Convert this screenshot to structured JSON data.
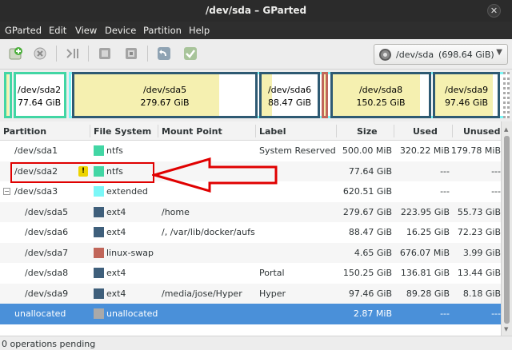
{
  "window": {
    "title": "/dev/sda – GParted",
    "close_glyph": "✕"
  },
  "menu": [
    "GParted",
    "Edit",
    "View",
    "Device",
    "Partition",
    "Help"
  ],
  "toolbar": {
    "buttons": [
      "new-partition",
      "delete-partition",
      "resize-move",
      "copy",
      "paste",
      "undo",
      "apply"
    ],
    "device": {
      "name": "/dev/sda",
      "size": "(698.64 GiB)"
    }
  },
  "partition_map": [
    {
      "name": "/dev/sda1",
      "size": "",
      "border": "#42d6a4",
      "used_fraction": 0.64
    },
    {
      "name": "/dev/sda2",
      "size": "77.64 GiB",
      "border": "#42d6a4",
      "used_fraction": 0.0
    },
    {
      "name": "/dev/sda5",
      "size": "279.67 GiB",
      "border": "#2e5a73",
      "used_fraction": 0.8
    },
    {
      "name": "/dev/sda6",
      "size": "88.47 GiB",
      "border": "#2e5a73",
      "used_fraction": 0.18
    },
    {
      "name": "/dev/sda7",
      "size": "",
      "border": "#c1665a",
      "used_fraction": 1.0
    },
    {
      "name": "/dev/sda8",
      "size": "150.25 GiB",
      "border": "#2e5a73",
      "used_fraction": 0.91
    },
    {
      "name": "/dev/sda9",
      "size": "97.46 GiB",
      "border": "#2e5a73",
      "used_fraction": 0.92
    },
    {
      "name": "unallocated",
      "size": "",
      "border": "#a9a9a9",
      "used_fraction": 0
    }
  ],
  "extended_color": "#7bf7f7",
  "table": {
    "headers": [
      "Partition",
      "File System",
      "Mount Point",
      "Label",
      "Size",
      "Used",
      "Unused"
    ],
    "rows": [
      {
        "partition": "/dev/sda1",
        "warn": false,
        "fs": "ntfs",
        "fs_color": "#42d6a4",
        "mount": "",
        "label": "System Reserved",
        "size": "500.00 MiB",
        "used": "320.22 MiB",
        "unused": "179.78 MiB",
        "indent": 0
      },
      {
        "partition": "/dev/sda2",
        "warn": true,
        "fs": "ntfs",
        "fs_color": "#42d6a4",
        "mount": "",
        "label": "",
        "size": "77.64 GiB",
        "used": "---",
        "unused": "---",
        "indent": 0
      },
      {
        "partition": "/dev/sda3",
        "warn": false,
        "fs": "extended",
        "fs_color": "#7bf7f7",
        "mount": "",
        "label": "",
        "size": "620.51 GiB",
        "used": "---",
        "unused": "---",
        "indent": 0,
        "expander": "−"
      },
      {
        "partition": "/dev/sda5",
        "warn": false,
        "fs": "ext4",
        "fs_color": "#3f5f7b",
        "mount": "/home",
        "label": "",
        "size": "279.67 GiB",
        "used": "223.95 GiB",
        "unused": "55.73 GiB",
        "indent": 1
      },
      {
        "partition": "/dev/sda6",
        "warn": false,
        "fs": "ext4",
        "fs_color": "#3f5f7b",
        "mount": "/, /var/lib/docker/aufs",
        "label": "",
        "size": "88.47 GiB",
        "used": "16.25 GiB",
        "unused": "72.23 GiB",
        "indent": 1
      },
      {
        "partition": "/dev/sda7",
        "warn": false,
        "fs": "linux-swap",
        "fs_color": "#c1665a",
        "mount": "",
        "label": "",
        "size": "4.65 GiB",
        "used": "676.07 MiB",
        "unused": "3.99 GiB",
        "indent": 1
      },
      {
        "partition": "/dev/sda8",
        "warn": false,
        "fs": "ext4",
        "fs_color": "#3f5f7b",
        "mount": "",
        "label": "Portal",
        "size": "150.25 GiB",
        "used": "136.81 GiB",
        "unused": "13.44 GiB",
        "indent": 1
      },
      {
        "partition": "/dev/sda9",
        "warn": false,
        "fs": "ext4",
        "fs_color": "#3f5f7b",
        "mount": "/media/jose/Hyper",
        "label": "Hyper",
        "size": "97.46 GiB",
        "used": "89.28 GiB",
        "unused": "8.18 GiB",
        "indent": 1
      },
      {
        "partition": "unallocated",
        "warn": false,
        "fs": "unallocated",
        "fs_color": "#a9a9a9",
        "mount": "",
        "label": "",
        "size": "2.87 MiB",
        "used": "---",
        "unused": "---",
        "indent": 0,
        "selected": true
      }
    ]
  },
  "status": "0 operations pending",
  "annotation_color": "#e00000"
}
